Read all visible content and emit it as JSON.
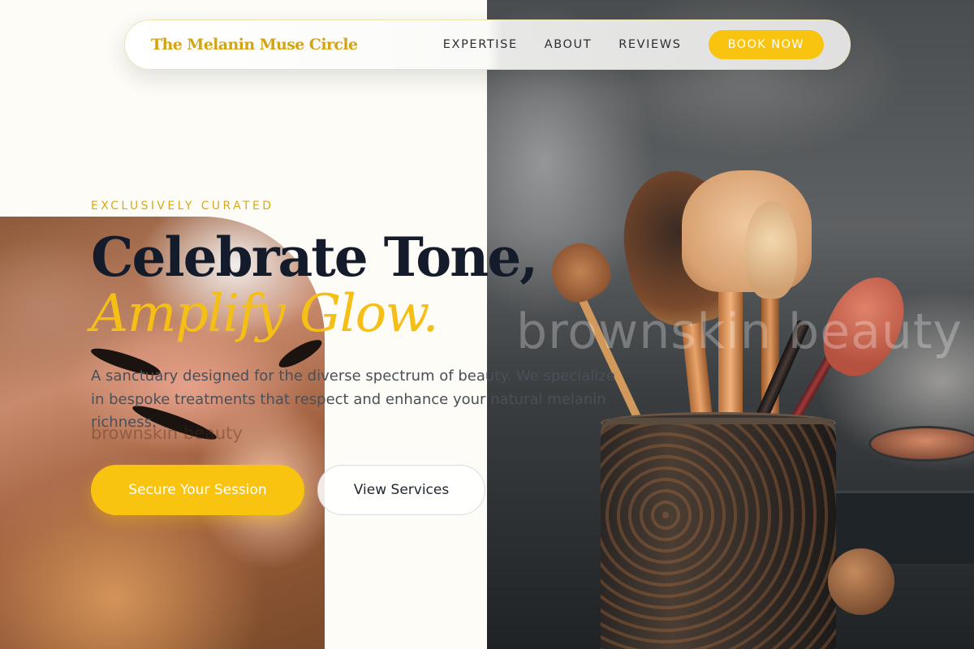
{
  "nav": {
    "brand": "The Melanin Muse Circle",
    "links": [
      "EXPERTISE",
      "ABOUT",
      "REVIEWS"
    ],
    "book_label": "BOOK NOW"
  },
  "hero": {
    "eyebrow": "EXCLUSIVELY CURATED",
    "headline_line1": "Celebrate Tone,",
    "headline_line2": "Amplify Glow.",
    "description": "A sanctuary designed for the diverse spectrum of beauty. We specialize in bespoke treatments that respect and enhance your natural melanin richness.",
    "primary_cta": "Secure Your Session",
    "secondary_cta": "View Services"
  },
  "images": {
    "right_watermark": "brownskin beauty",
    "left_watermark": "brownskin beauty"
  },
  "colors": {
    "accent": "#f9c410",
    "brand_gold": "#d3a514",
    "headline": "#141b2b",
    "background": "#fdfcf6"
  }
}
